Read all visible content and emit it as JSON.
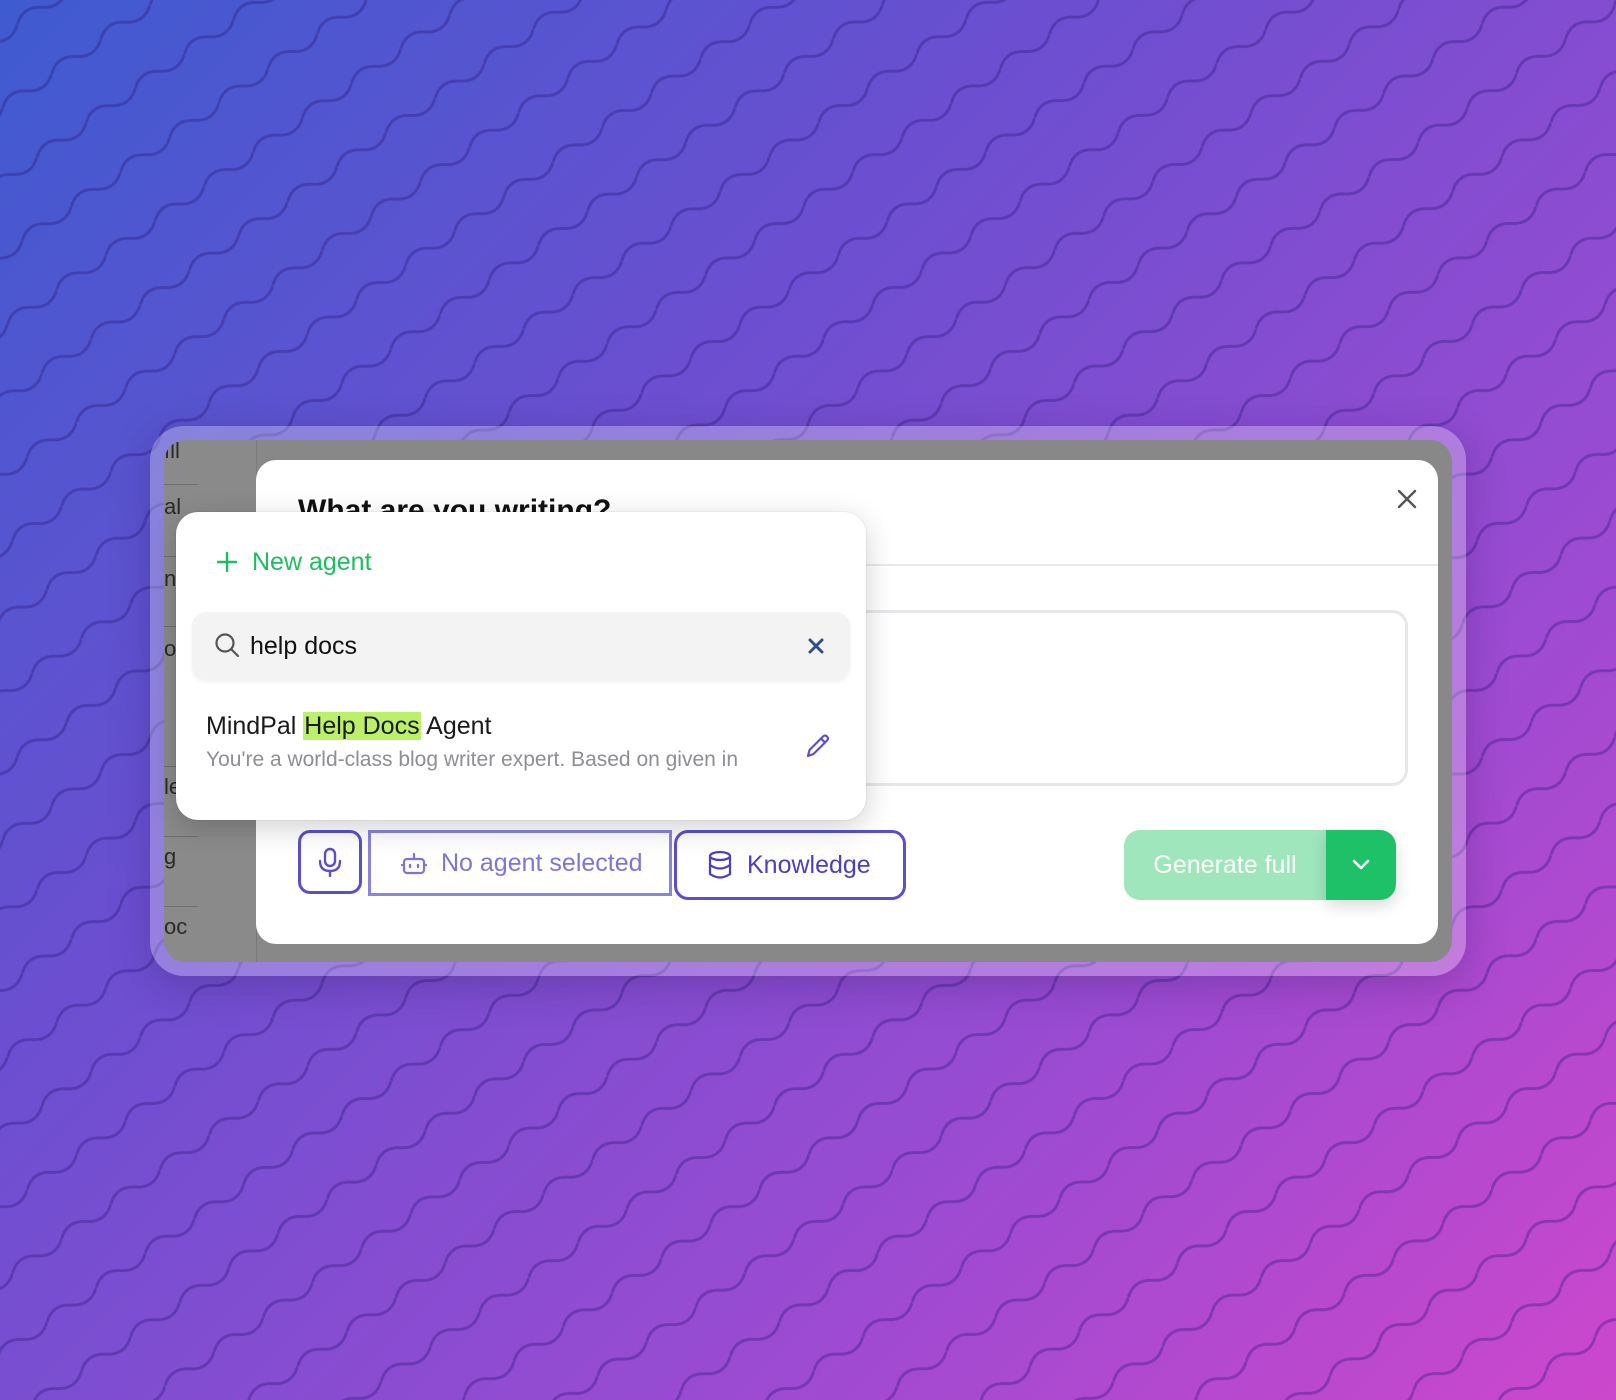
{
  "modal": {
    "title": "What are you writing?",
    "close_icon": "close-icon"
  },
  "dropdown": {
    "new_agent_label": "New agent",
    "search_value": "help docs",
    "search_placeholder": "",
    "result": {
      "title_prefix": "MindPal ",
      "title_highlight": "Help Docs",
      "title_suffix": " Agent",
      "description": "You're a world-class blog writer expert. Based on given in"
    }
  },
  "toolbar": {
    "mic_icon": "microphone-icon",
    "agent_label": "No agent selected",
    "knowledge_label": "Knowledge",
    "generate_label": "Generate full"
  },
  "colors": {
    "accent_purple": "#5b4fcf",
    "accent_green": "#1ec167",
    "highlight": "#bdf06a"
  }
}
